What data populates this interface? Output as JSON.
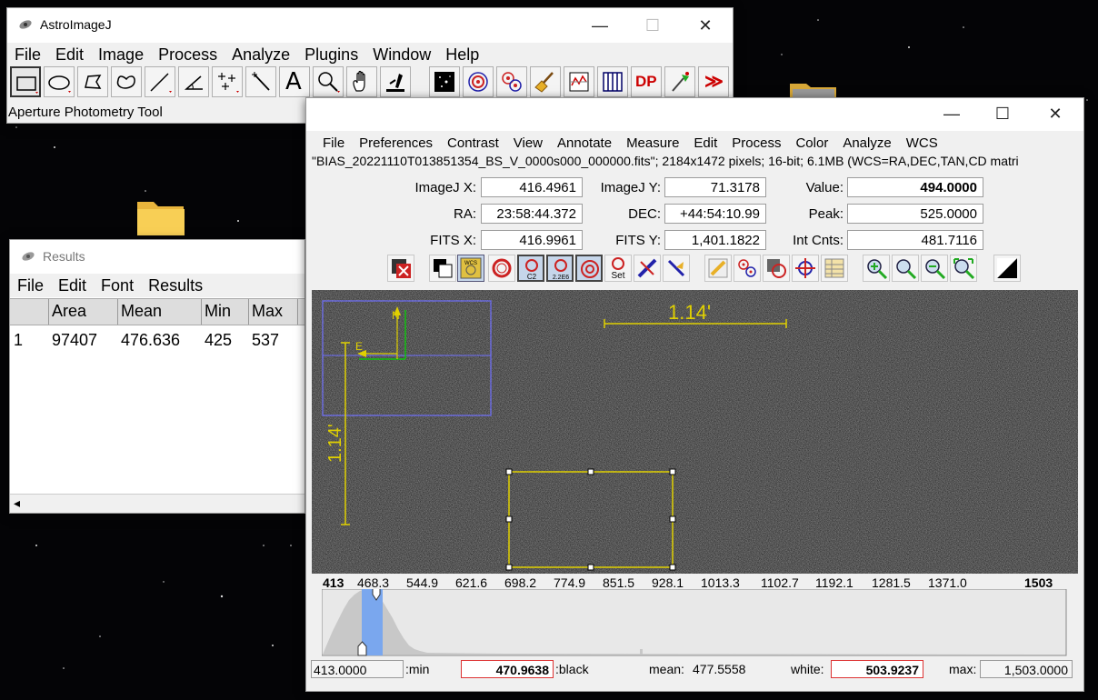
{
  "desktop": {
    "background": "#040406"
  },
  "main_window": {
    "title": "AstroImageJ",
    "controls": {
      "minimize": "—",
      "maximize": "☐",
      "close": "✕"
    },
    "menu": [
      "File",
      "Edit",
      "Image",
      "Process",
      "Analyze",
      "Plugins",
      "Window",
      "Help"
    ],
    "status": "Aperture Photometry Tool",
    "tools": [
      "rectangle-tool",
      "oval-tool",
      "polygon-tool",
      "freehand-tool",
      "line-tool",
      "angle-tool",
      "point-tool",
      "wand-tool",
      "text-tool",
      "magnifier-tool",
      "scroll-tool",
      "dropper-tool",
      "image-display-tool",
      "aperture-tool",
      "multi-aperture-tool",
      "clear-tool",
      "plot-tool",
      "stack-tool",
      "dp-tool",
      "astrometry-tool",
      "more-tools"
    ],
    "tool_glyphs": {
      "text-tool": "A",
      "dp-tool": "DP",
      "more-tools": "≫"
    }
  },
  "results_window": {
    "title": "Results",
    "menu": [
      "File",
      "Edit",
      "Font",
      "Results"
    ],
    "columns": [
      "",
      "Area",
      "Mean",
      "Min",
      "Max"
    ],
    "rows": [
      [
        "1",
        "97407",
        "476.636",
        "425",
        "537"
      ]
    ],
    "scroll_left": "◂"
  },
  "image_window": {
    "controls": {
      "minimize": "—",
      "maximize": "☐",
      "close": "✕"
    },
    "menu": [
      "File",
      "Preferences",
      "Contrast",
      "View",
      "Annotate",
      "Measure",
      "Edit",
      "Process",
      "Color",
      "Analyze",
      "WCS"
    ],
    "subtitle": "\"BIAS_20221110T013851354_BS_V_0000s000_000000.fits\"; 2184x1472 pixels; 16-bit; 6.1MB (WCS=RA,DEC,TAN,CD matri",
    "info": {
      "imagej_x_label": "ImageJ X:",
      "imagej_x": "416.4961",
      "imagej_y_label": "ImageJ Y:",
      "imagej_y": "71.3178",
      "value_label": "Value:",
      "value": "494.0000",
      "ra_label": "RA:",
      "ra": "23:58:44.372",
      "dec_label": "DEC:",
      "dec": "+44:54:10.99",
      "peak_label": "Peak:",
      "peak": "525.0000",
      "fits_x_label": "FITS X:",
      "fits_x": "416.9961",
      "fits_y_label": "FITS Y:",
      "fits_y": "1,401.1822",
      "int_cnts_label": "Int Cnts:",
      "int_cnts": "481.7116"
    },
    "icon_labels": {
      "c2": "C2",
      "2e6": "2.2E6",
      "set": "Set",
      "n": "N",
      "e": "E",
      "wcs": "WCS"
    },
    "image": {
      "scale_label": "1.14'",
      "vertical_scale_label": "1.14'",
      "roi_color": "#e0d000",
      "compass_box_color": "#7070ff"
    },
    "histogram_axis": [
      "413",
      "468.3",
      "544.9",
      "621.6",
      "698.2",
      "774.9",
      "851.5",
      "928.1",
      "1013.3",
      "1102.7",
      "1192.1",
      "1281.5",
      "1371.0",
      "1503"
    ],
    "bottom": {
      "min_value": "413.0000",
      "min_label": ":min",
      "black_value": "470.9638",
      "black_label": ":black",
      "mean_label": "mean:",
      "mean_value": "477.5558",
      "white_label": "white:",
      "white_value": "503.9237",
      "max_label": "max:",
      "max_value": "1,503.0000"
    },
    "histogram_color": "#7aa7ee"
  }
}
